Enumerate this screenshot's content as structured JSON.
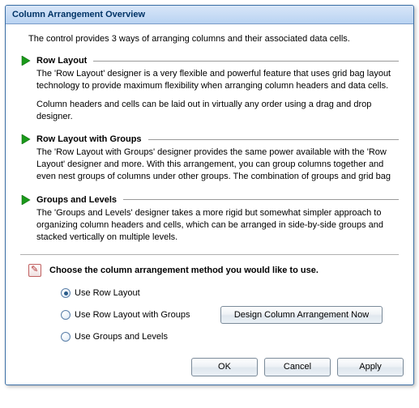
{
  "title": "Column Arrangement Overview",
  "intro": "The control provides 3 ways of arranging columns and their associated data cells.",
  "sections": [
    {
      "title": "Row Layout",
      "para1": "The 'Row Layout' designer is a very flexible and powerful feature that uses grid bag layout technology to provide maximum flexibility when arranging column headers and data cells.",
      "para2": "Column headers and cells can be laid out in virtually any order using a drag and drop designer."
    },
    {
      "title": "Row Layout with Groups",
      "para1": "The 'Row Layout with Groups' designer provides the same power available with the 'Row Layout' designer and more. With this arrangement, you can group columns together and even nest groups of columns under other groups. The combination of groups and grid bag"
    },
    {
      "title": "Groups and Levels",
      "para1": "The 'Groups and Levels' designer takes a more rigid but somewhat simpler approach to organizing column headers and cells, which can be arranged in side-by-side groups and stacked vertically on multiple  levels."
    }
  ],
  "choose_label": "Choose the column arrangement method you would like to use.",
  "options": [
    {
      "label": "Use Row Layout",
      "selected": true
    },
    {
      "label": "Use Row Layout with Groups",
      "selected": false
    },
    {
      "label": "Use Groups and Levels",
      "selected": false
    }
  ],
  "design_button": "Design Column Arrangement Now",
  "buttons": {
    "ok": "OK",
    "cancel": "Cancel",
    "apply": "Apply"
  }
}
